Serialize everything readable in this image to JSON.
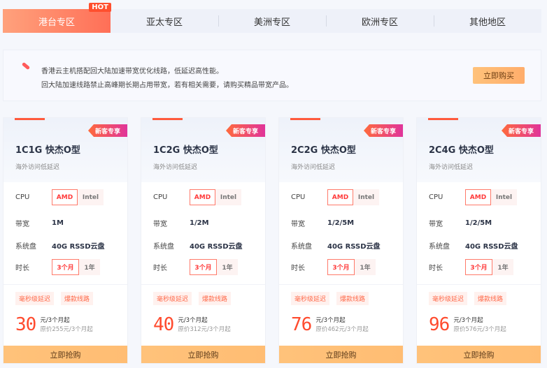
{
  "tabs": [
    {
      "label": "港台专区",
      "hot": "HOT"
    },
    {
      "label": "亚太专区"
    },
    {
      "label": "美洲专区"
    },
    {
      "label": "欧洲专区"
    },
    {
      "label": "其他地区"
    }
  ],
  "notice": {
    "line1": "香港云主机搭配回大陆加速带宽优化线路，低延迟高性能。",
    "line2": "回大陆加速线路禁止高峰期长期占用带宽，若有相关需要，请购买精品带宽产品。",
    "button": "立即购买"
  },
  "labels": {
    "cpu": "CPU",
    "bandwidth": "带宽",
    "disk": "系统盘",
    "duration": "时长"
  },
  "cards": [
    {
      "tag": "新客专享",
      "title": "1C1G 快杰O型",
      "sub": "海外访问低延迟",
      "cpu": [
        "AMD",
        "Intel"
      ],
      "bandwidth": "1M",
      "disk": "40G RSSD云盘",
      "duration": [
        "3个月",
        "1年"
      ],
      "chips": [
        "毫秒级延迟",
        "爆款线路"
      ],
      "price": "30",
      "unit": "元/3个月起",
      "orig": "原价255元/3个月起",
      "button": "立即抢购"
    },
    {
      "tag": "新客专享",
      "title": "1C2G 快杰O型",
      "sub": "海外访问低延迟",
      "cpu": [
        "AMD",
        "Intel"
      ],
      "bandwidth": "1/2M",
      "disk": "40G RSSD云盘",
      "duration": [
        "3个月",
        "1年"
      ],
      "chips": [
        "毫秒级延迟",
        "爆款线路"
      ],
      "price": "40",
      "unit": "元/3个月起",
      "orig": "原价312元/3个月起",
      "button": "立即抢购"
    },
    {
      "tag": "新客专享",
      "title": "2C2G 快杰O型",
      "sub": "海外访问低延迟",
      "cpu": [
        "AMD",
        "Intel"
      ],
      "bandwidth": "1/2/5M",
      "disk": "40G RSSD云盘",
      "duration": [
        "3个月",
        "1年"
      ],
      "chips": [
        "毫秒级延迟",
        "爆款线路"
      ],
      "price": "76",
      "unit": "元/3个月起",
      "orig": "原价462元/3个月起",
      "button": "立即抢购"
    },
    {
      "tag": "新客专享",
      "title": "2C4G 快杰O型",
      "sub": "海外访问低延迟",
      "cpu": [
        "AMD",
        "Intel"
      ],
      "bandwidth": "1/2/5M",
      "disk": "40G RSSD云盘",
      "duration": [
        "3个月",
        "1年"
      ],
      "chips": [
        "毫秒级延迟",
        "爆款线路"
      ],
      "price": "96",
      "unit": "元/3个月起",
      "orig": "原价576元/3个月起",
      "button": "立即抢购"
    }
  ]
}
